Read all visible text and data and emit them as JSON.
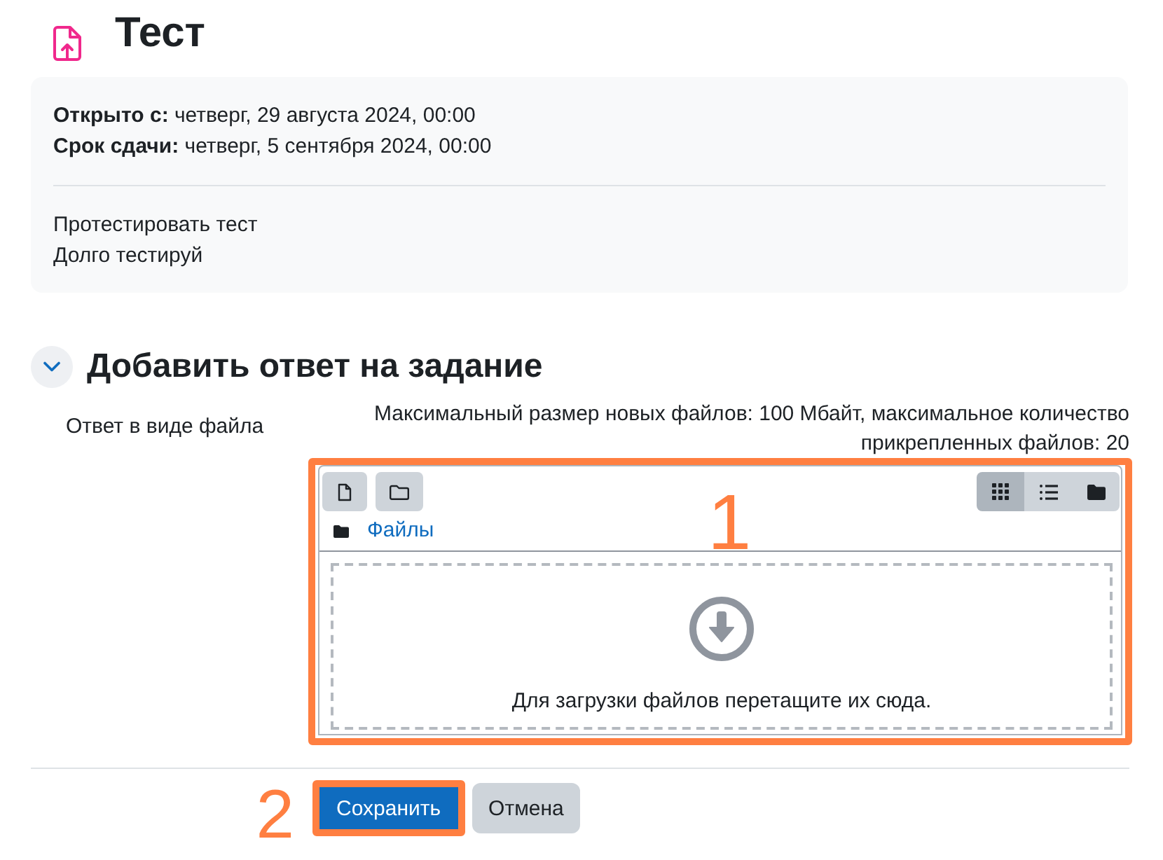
{
  "page": {
    "title": "Тест"
  },
  "info": {
    "dates": [
      "**Открыто с:** четверг, 29 августа 2024, 00:00",
      "**Срок сдачи:** четверг, 5 сентября 2024, 00:00"
    ],
    "description": [
      "Протестировать тест",
      "Долго тестируй"
    ]
  },
  "section": {
    "title": "Добавить ответ на задание",
    "expanded": true
  },
  "file_field": {
    "label": "Ответ в виде файла",
    "limits": "Максимальный размер новых файлов: 100 Мбайт, максимальное количество прикрепленных файлов: 20",
    "annotation": "1",
    "toolbar": [
      {
        "kind": "add-file"
      },
      {
        "kind": "create-folder"
      }
    ],
    "views": [
      {
        "kind": "icons",
        "selected": true
      },
      {
        "kind": "list",
        "selected": false
      },
      {
        "kind": "tree",
        "selected": false
      }
    ],
    "breadcrumb": "Файлы",
    "dropzone_text": "Для загрузки файлов перетащите их сюда."
  },
  "buttons": [
    {
      "label": "Сохранить",
      "kind": "primary",
      "annotation": "2"
    },
    {
      "label": "Отмена",
      "kind": "secondary"
    }
  ]
}
